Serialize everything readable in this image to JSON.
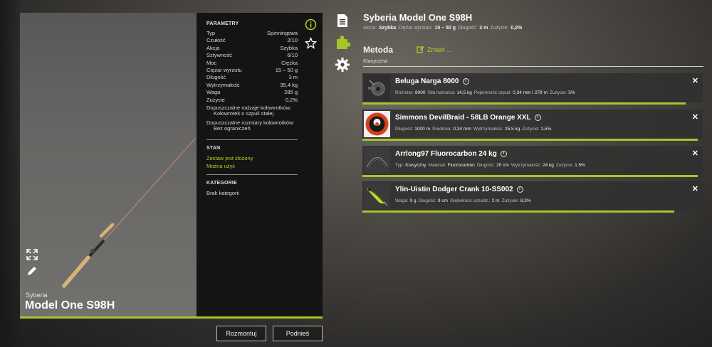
{
  "rod": {
    "brand": "Syberia",
    "name": "Model One S98H"
  },
  "params": {
    "title": "PARAMETRY",
    "rows": [
      {
        "label": "Typ",
        "value": "Spinningowa"
      },
      {
        "label": "Czułość",
        "value": "2/10"
      },
      {
        "label": "Akcja",
        "value": "Szybka"
      },
      {
        "label": "Sztywność",
        "value": "6/10"
      },
      {
        "label": "Moc",
        "value": "Ciężka"
      },
      {
        "label": "Ciężar wyrzutu",
        "value": "15 – 50 g"
      },
      {
        "label": "Długość",
        "value": "3 m"
      },
      {
        "label": "Wytrzymałość",
        "value": "35,4 kg"
      },
      {
        "label": "Waga",
        "value": "285 g"
      },
      {
        "label": "Zużycie",
        "value": "0,2%"
      }
    ],
    "reel_types_label": "Dopuszczalne rodzaje kołowrotków:",
    "reel_types_value": "Kołowrotek o szpuli stałej",
    "reel_sizes_label": "Dopuszczalne rozmiary kołowrotków:",
    "reel_sizes_value": "Bez ograniczeń"
  },
  "status": {
    "title": "STAN",
    "assembled": "Zestaw jest złożony",
    "usable": "Można użyć"
  },
  "categories": {
    "title": "KATEGORIE",
    "value": "Brak kategorii"
  },
  "buttons": {
    "disassemble": "Rozmontuj",
    "lift": "Podnieś"
  },
  "summary": {
    "title": "Syberia Model One S98H",
    "stats": [
      {
        "label": "Akcja:",
        "value": "Szybka"
      },
      {
        "label": "Ciężar wyrzutu:",
        "value": "15 – 50 g"
      },
      {
        "label": "Długość:",
        "value": "3 m"
      },
      {
        "label": "Zużycie:",
        "value": "0,2%"
      }
    ]
  },
  "method": {
    "title": "Metoda",
    "change_label": "Zmień ...",
    "value": "Klasyczna"
  },
  "components": [
    {
      "name": "Beluga Narga 8000",
      "attrs": [
        {
          "label": "Rozmiar:",
          "value": "8000"
        },
        {
          "label": "Siła hamulca:",
          "value": "14,5 kg"
        },
        {
          "label": "Pojemność szpuli:",
          "value": "0,34 mm / 279 m"
        },
        {
          "label": "Zużycie:",
          "value": "5%"
        }
      ],
      "condition": 0.95
    },
    {
      "name": "Simmons DevilBraid - 58LB Orange XXL",
      "attrs": [
        {
          "label": "Długość:",
          "value": "1000 m"
        },
        {
          "label": "Średnica:",
          "value": "0,34 mm"
        },
        {
          "label": "Wytrzymałość:",
          "value": "26,5 kg"
        },
        {
          "label": "Zużycie:",
          "value": "1,5%"
        }
      ],
      "condition": 0.985
    },
    {
      "name": "Arrlong97 Fluorocarbon 24 kg",
      "attrs": [
        {
          "label": "Typ:",
          "value": "Klasyczny"
        },
        {
          "label": "Materiał:",
          "value": "Fluorocarbon"
        },
        {
          "label": "Długość:",
          "value": "20 cm"
        },
        {
          "label": "Wytrzymałość:",
          "value": "24 kg"
        },
        {
          "label": "Zużycie:",
          "value": "1,5%"
        }
      ],
      "condition": 0.985
    },
    {
      "name": "Ylin-Uistin Dodger Crank 10-SS002",
      "attrs": [
        {
          "label": "Waga:",
          "value": "9 g"
        },
        {
          "label": "Długość:",
          "value": "9 cm"
        },
        {
          "label": "Głębokość schodz.:",
          "value": "2 m"
        },
        {
          "label": "Zużycie:",
          "value": "8,3%"
        }
      ],
      "condition": 0.917
    }
  ],
  "colors": {
    "accent": "#a7c52a",
    "accent_text": "#b4d22a",
    "panel_dark": "#141414"
  },
  "icons": {
    "info": "info-circle-icon",
    "favorite": "star-icon",
    "expand": "expand-icon",
    "edit": "pencil-icon",
    "details_tab": "document-icon",
    "puzzle_tab": "puzzle-icon",
    "settings_tab": "gear-icon",
    "close": "close-icon"
  }
}
